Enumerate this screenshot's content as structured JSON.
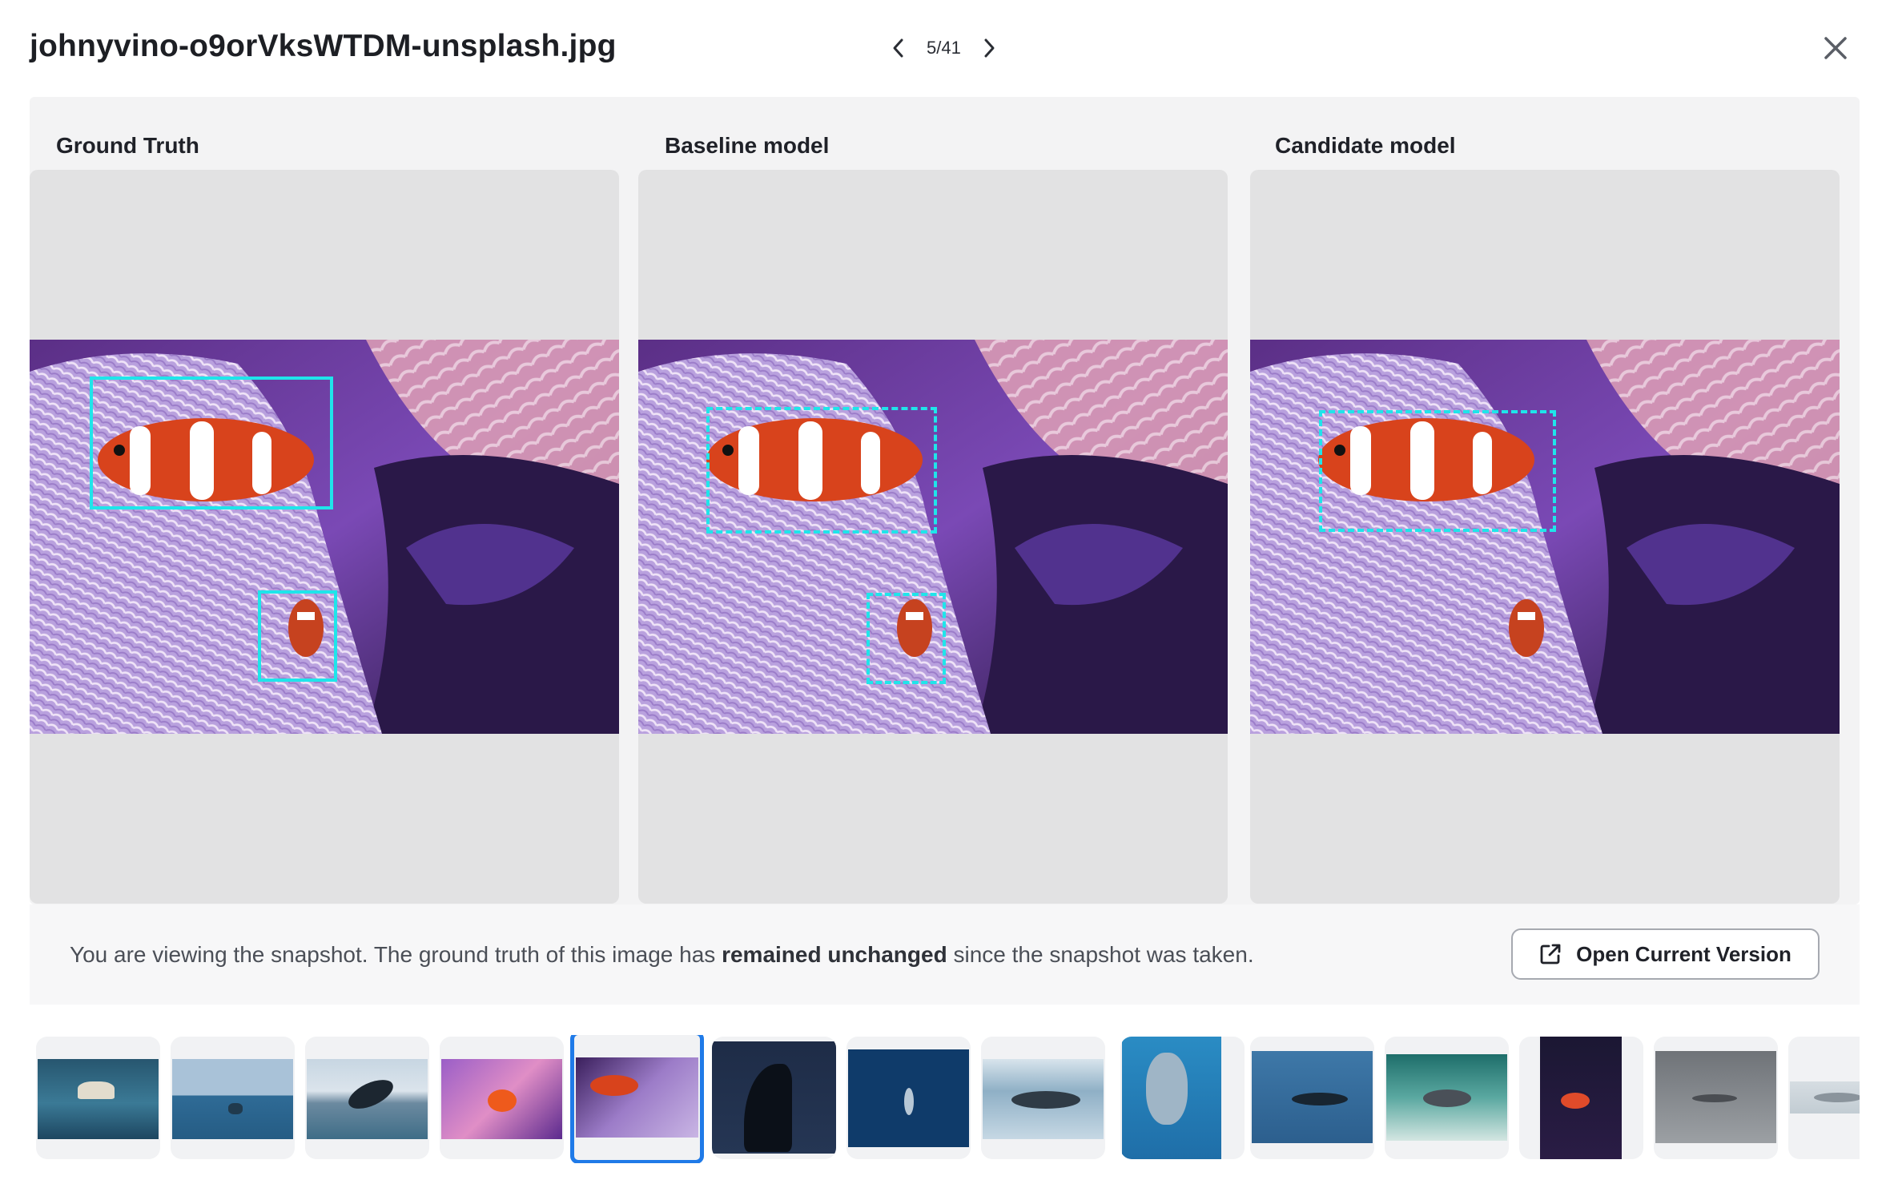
{
  "header": {
    "filename": "johnyvino-o9orVksWTDM-unsplash.jpg",
    "counter": "5/41",
    "prev_icon": "chevron-left-icon",
    "next_icon": "chevron-right-icon",
    "close_icon": "close-icon"
  },
  "panels": [
    {
      "title": "Ground Truth"
    },
    {
      "title": "Baseline model"
    },
    {
      "title": "Candidate model"
    }
  ],
  "annotation_color": "#1fe5ea",
  "notice": {
    "prefix": "You are viewing the snapshot. The ground truth of this image has ",
    "emphasis": "remained unchanged",
    "suffix": " since the snapshot was taken.",
    "button_label": "Open Current Version",
    "button_icon": "external-link-icon"
  },
  "thumbnails": {
    "count": 14,
    "selected_index": 4,
    "selected_color": "#1f7ae8"
  }
}
